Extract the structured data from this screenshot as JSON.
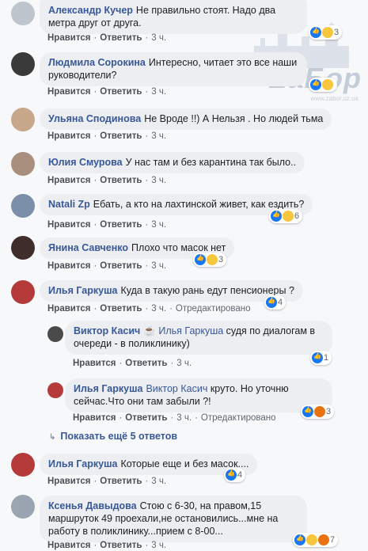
{
  "watermark": {
    "text": "ZaБор",
    "url": "www.zabor.uz.ua"
  },
  "comments": [
    {
      "author": "Александр Кучер",
      "text": "Не правильно стоят. Надо два метра друг от друга.",
      "like": "Нравится",
      "reply": "Ответить",
      "time": "3 ч.",
      "count": "3"
    },
    {
      "author": "Людмила Сорокина",
      "text": "Интересно, читает это все наши руководители?",
      "like": "Нравится",
      "reply": "Ответить",
      "time": "3 ч.",
      "count": ""
    },
    {
      "author": "Ульяна Сподинова",
      "text": "Не Вроде !!) А Нельзя . Но людей тьма",
      "like": "Нравится",
      "reply": "Ответить",
      "time": "3 ч."
    },
    {
      "author": "Юлия Смурова",
      "text": "У нас там и без карантина так было..",
      "like": "Нравится",
      "reply": "Ответить",
      "time": "3 ч."
    },
    {
      "author": "Natali Zp",
      "text": "Ебать, а кто на лахтинской живет, как ездить?",
      "like": "Нравится",
      "reply": "Ответить",
      "time": "3 ч.",
      "count": "6"
    },
    {
      "author": "Янина Савченко",
      "text": "Плохо что масок нет",
      "like": "Нравится",
      "reply": "Ответить",
      "time": "3 ч.",
      "count": "3"
    },
    {
      "author": "Илья Гаркуша",
      "text": "Куда в такую рань едут пенсионеры ?",
      "like": "Нравится",
      "reply": "Ответить",
      "time": "3 ч.",
      "edited": "Отредактировано",
      "count": "4"
    },
    {
      "author": "Виктор Касич",
      "mention": "Илья Гаркуша",
      "text": "судя по диалогам в очереди - в поликлинику)",
      "like": "Нравится",
      "reply": "Ответить",
      "time": "3 ч.",
      "count": "1"
    },
    {
      "author": "Илья Гаркуша",
      "mention": "Виктор Касич",
      "text": "круто. Но уточню сейчас.Что они там забыли ?!",
      "like": "Нравится",
      "reply": "Ответить",
      "time": "3 ч.",
      "edited": "Отредактировано",
      "count": "3"
    },
    {
      "author": "Илья Гаркуша",
      "text": "Которые еще и без масок....",
      "like": "Нравится",
      "reply": "Ответить",
      "time": "3 ч.",
      "count": "4"
    },
    {
      "author": "Ксенья Давыдова",
      "text": "Стою с 6-30, на правом,15 маршруток 49 проехали,не остановились...мне на работу в поликлинику...прием с 8-00...",
      "like": "Нравится",
      "reply": "Ответить",
      "time": "3 ч.",
      "count": "7"
    }
  ],
  "show_more": "Показать ещё 5 ответов",
  "colors": {
    "link": "#385898",
    "bubble": "#edeef1",
    "like": "#1877f2"
  }
}
